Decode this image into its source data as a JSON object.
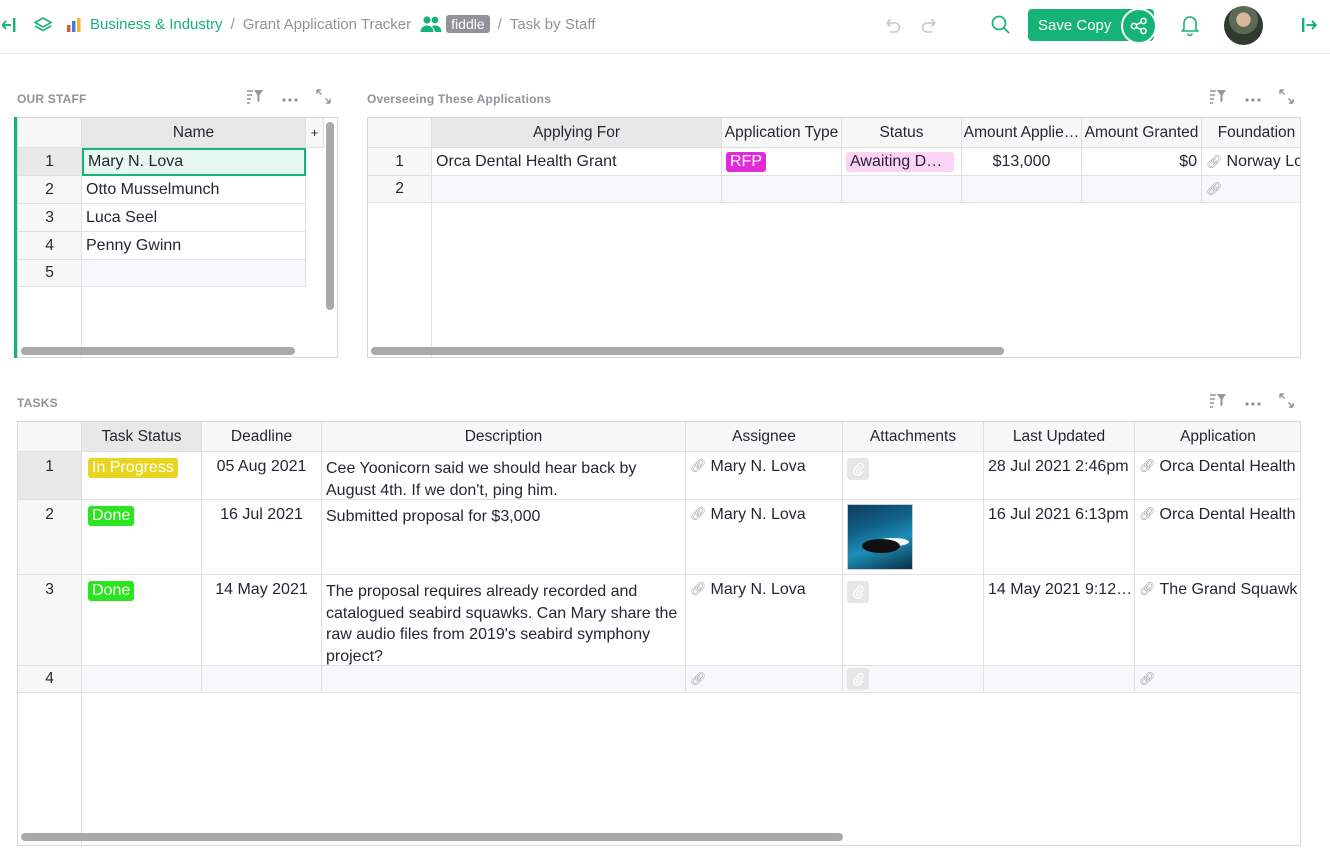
{
  "topbar": {
    "category": "Business & Industry",
    "doc_title": "Grant Application Tracker",
    "workspace_tag": "fiddle",
    "page_name": "Task by Staff",
    "save_copy_label": "Save Copy"
  },
  "staff": {
    "section_title": "OUR STAFF",
    "column": "Name",
    "add_col": "+",
    "rows": [
      "Mary N. Lova",
      "Otto Musselmunch",
      "Luca Seel",
      "Penny Gwinn"
    ],
    "row_numbers": [
      "1",
      "2",
      "3",
      "4",
      "5"
    ]
  },
  "apps": {
    "section_title": "Overseeing These Applications",
    "columns": [
      "Applying For",
      "Application Type",
      "Status",
      "Amount Applie…",
      "Amount Granted",
      "Foundation"
    ],
    "rows": [
      {
        "num": "1",
        "applying_for": "Orca Dental Health Grant",
        "type": "RFP",
        "status": "Awaiting D…",
        "amount_applied": "$13,000",
        "amount_granted": "$0",
        "foundation": "Norway Lo"
      },
      {
        "num": "2"
      }
    ],
    "colors": {
      "rfp": "#e22ad6",
      "status": "#fbd3f5"
    }
  },
  "tasks": {
    "section_title": "TASKS",
    "columns": [
      "Task Status",
      "Deadline",
      "Description",
      "Assignee",
      "Attachments",
      "Last Updated",
      "Application"
    ],
    "rows": [
      {
        "num": "1",
        "status": "In Progress",
        "deadline": "05 Aug 2021",
        "description": "Cee Yoonicorn said we should hear back by August 4th. If we don't, ping him.",
        "assignee": "Mary N. Lova",
        "updated": "28 Jul 2021 2:46pm",
        "application": "Orca Dental Health G"
      },
      {
        "num": "2",
        "status": "Done",
        "deadline": "16 Jul 2021",
        "description": "Submitted proposal for $3,000",
        "assignee": "Mary N. Lova",
        "updated": "16 Jul 2021 6:13pm",
        "application": "Orca Dental Health G"
      },
      {
        "num": "3",
        "status": "Done",
        "deadline": "14 May 2021",
        "description": "The proposal requires already recorded and catalogued seabird squawks. Can Mary share the raw audio files from 2019's seabird symphony project?",
        "assignee": "Mary N. Lova",
        "updated": "14 May 2021 9:12…",
        "application": "The Grand Squawk"
      },
      {
        "num": "4"
      }
    ],
    "colors": {
      "in_progress": "#e8d51f",
      "done": "#2ae51f"
    }
  },
  "icons": [
    "back-arrow-icon",
    "layers-icon",
    "chart-icon",
    "users-icon",
    "undo-icon",
    "redo-icon",
    "search-icon",
    "share-icon",
    "bell-icon",
    "exit-icon",
    "sort-filter-icon",
    "more-icon",
    "expand-icon",
    "link-icon",
    "paperclip-icon"
  ]
}
